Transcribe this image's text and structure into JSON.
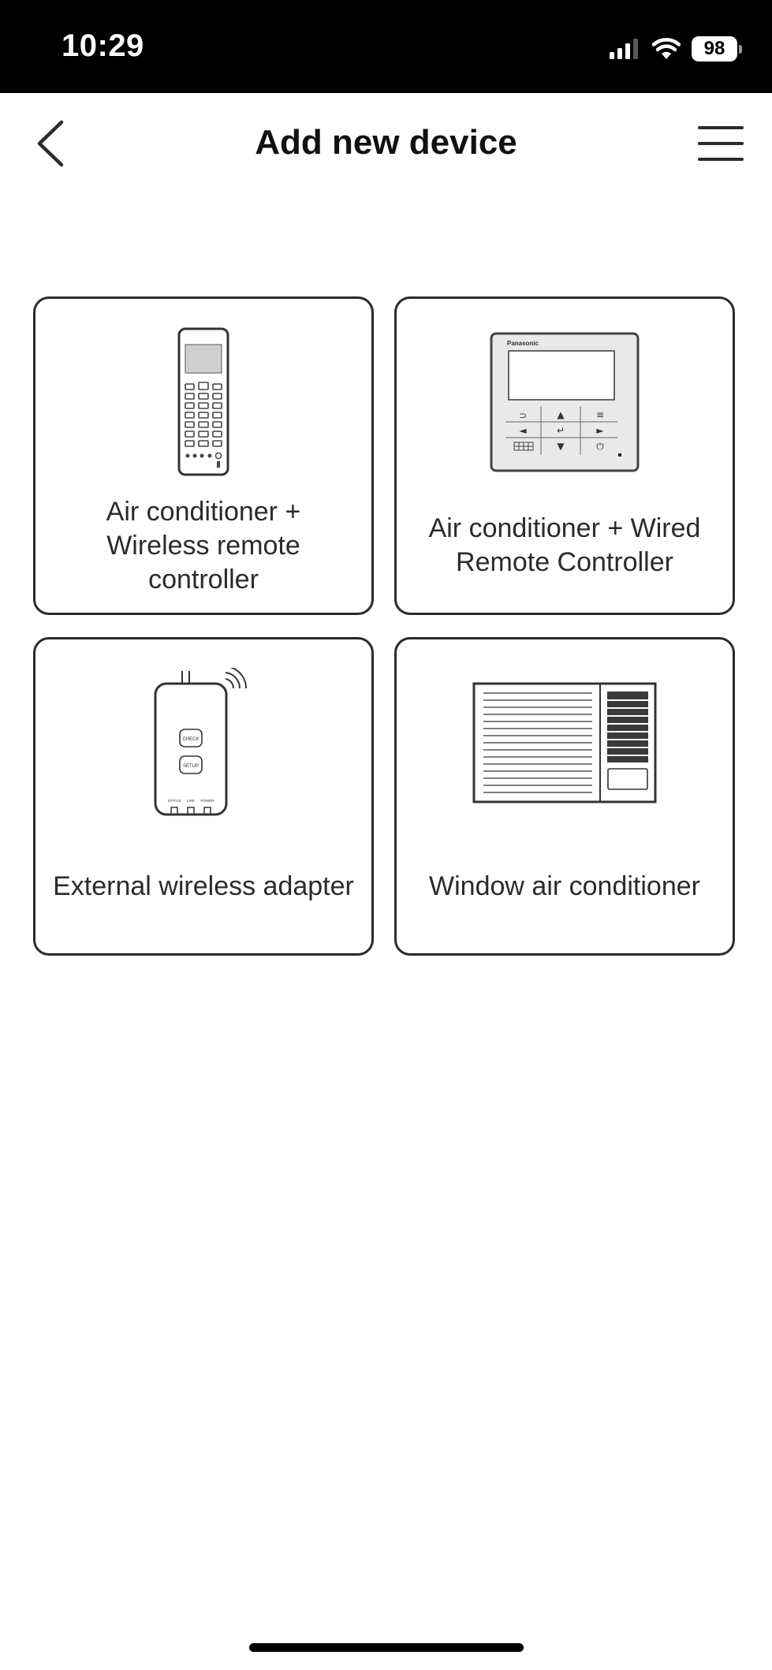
{
  "status_bar": {
    "time": "10:29",
    "battery": "98",
    "icons": [
      "signal-icon",
      "wifi-icon",
      "battery-icon"
    ]
  },
  "nav": {
    "title": "Add new device",
    "back_icon": "chevron-left-icon",
    "menu_icon": "hamburger-menu-icon"
  },
  "devices": [
    {
      "label": "Air conditioner + Wireless remote controller",
      "icon": "wireless-remote-icon"
    },
    {
      "label": "Air conditioner + Wired Remote Controller",
      "icon": "wired-remote-controller-icon",
      "brand_text": "Panasonic"
    },
    {
      "label": "External wireless adapter",
      "icon": "wireless-adapter-icon",
      "button_labels": [
        "CHECK",
        "SETUP"
      ],
      "led_labels": [
        "STATUS",
        "LINK",
        "POWER"
      ]
    },
    {
      "label": "Window air conditioner",
      "icon": "window-air-conditioner-icon"
    }
  ],
  "colors": {
    "background": "#ffffff",
    "status_bar": "#000000",
    "card_border": "#2b2b2b",
    "text": "#2b2b2b"
  }
}
